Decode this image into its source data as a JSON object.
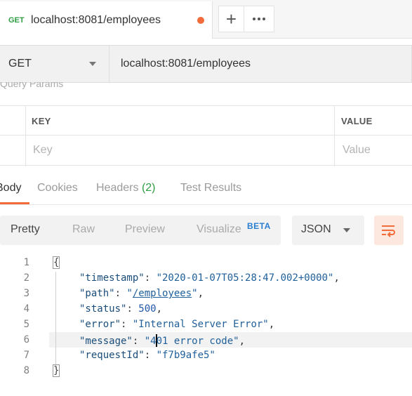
{
  "tab": {
    "method": "GET",
    "title": "localhost:8081/employees",
    "unsaved_color": "#f26b3a",
    "add_icon": "plus-icon",
    "more_icon": "more-horizontal-icon"
  },
  "request": {
    "method": "GET",
    "url": "localhost:8081/employees"
  },
  "params": {
    "section_title": "Query Params",
    "columns": [
      "KEY",
      "VALUE"
    ],
    "key_placeholder": "Key",
    "value_placeholder": "Value"
  },
  "response_tabs": {
    "body": "Body",
    "cookies": "Cookies",
    "headers": "Headers",
    "headers_count": "(2)",
    "tests": "Test Results",
    "active_color": "#f26b3a"
  },
  "view": {
    "pretty": "Pretty",
    "raw": "Raw",
    "preview": "Preview",
    "visualize": "Visualize",
    "beta": "BETA",
    "format": "JSON",
    "wrap_icon": "wrap-lines-icon"
  },
  "code": {
    "line_numbers": [
      "1",
      "2",
      "3",
      "4",
      "5",
      "6",
      "7",
      "8"
    ],
    "open_brace": "{",
    "close_brace": "}",
    "timestamp_key": "\"timestamp\"",
    "timestamp_val": "\"2020-01-07T05:28:47.002+0000\"",
    "path_key": "\"path\"",
    "path_val_q1": "\"",
    "path_val": "/employees",
    "path_val_q2": "\"",
    "status_key": "\"status\"",
    "status_val": "500",
    "error_key": "\"error\"",
    "error_val": "\"Internal Server Error\"",
    "message_key": "\"message\"",
    "message_val_a": "\"4",
    "message_val_b": "01 error code\"",
    "requestId_key": "\"requestId\"",
    "requestId_val": "\"f7b9afe5\""
  }
}
